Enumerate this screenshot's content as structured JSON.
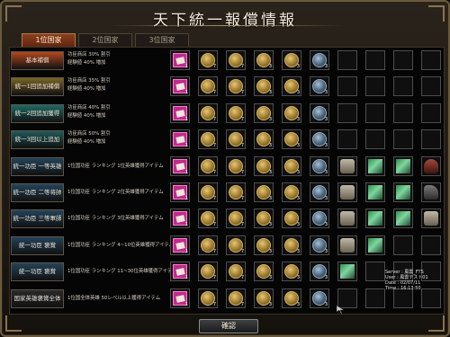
{
  "window": {
    "title": "天下統一報償情報",
    "confirm_label": "確認"
  },
  "tabs": [
    {
      "label": "1位国家",
      "active": true
    },
    {
      "label": "2位国家",
      "active": false
    },
    {
      "label": "3位国家",
      "active": false
    }
  ],
  "rows": [
    {
      "rank": "基本補償",
      "rank_color": "#b0481f",
      "line1": "功臣商店 30% 割引",
      "line2": "経験値 40% 増加",
      "items": [
        {
          "icon": "scroll-icon",
          "qty": "1"
        },
        {
          "icon": "coin-icon",
          "qty": "7"
        },
        {
          "icon": "coin-icon",
          "qty": "7"
        },
        {
          "icon": "coin-icon",
          "qty": "3"
        },
        {
          "icon": "coin-icon",
          "qty": "3"
        },
        {
          "icon": "coin-blue-icon",
          "qty": "3"
        }
      ]
    },
    {
      "rank": "統一1回追加補償",
      "rank_color": "#7a6427",
      "line1": "功臣商店 35% 割引",
      "line2": "経験値 40% 増加",
      "items": [
        {
          "icon": "scroll-icon",
          "qty": "1"
        },
        {
          "icon": "coin-icon",
          "qty": "7"
        },
        {
          "icon": "coin-icon",
          "qty": "7"
        },
        {
          "icon": "coin-icon",
          "qty": "3"
        },
        {
          "icon": "coin-icon",
          "qty": "3"
        },
        {
          "icon": "coin-blue-icon",
          "qty": "3"
        }
      ]
    },
    {
      "rank": "統一2回追加獲得",
      "rank_color": "#1f6a64",
      "line1": "功臣商店 40% 割引",
      "line2": "経験値 40% 増加",
      "items": [
        {
          "icon": "scroll-icon",
          "qty": "1"
        },
        {
          "icon": "coin-icon",
          "qty": "7"
        },
        {
          "icon": "coin-icon",
          "qty": "7"
        },
        {
          "icon": "coin-icon",
          "qty": "3"
        },
        {
          "icon": "coin-icon",
          "qty": "3"
        },
        {
          "icon": "coin-blue-icon",
          "qty": "3"
        }
      ]
    },
    {
      "rank": "統一3回以上追加",
      "rank_color": "#1f5a5a",
      "line1": "功臣商店 50% 割引",
      "line2": "経験値 40% 増加",
      "items": [
        {
          "icon": "scroll-icon",
          "qty": "1"
        },
        {
          "icon": "coin-icon",
          "qty": "7"
        },
        {
          "icon": "coin-icon",
          "qty": "7"
        },
        {
          "icon": "coin-icon",
          "qty": "3"
        },
        {
          "icon": "coin-icon",
          "qty": "3"
        },
        {
          "icon": "coin-blue-icon",
          "qty": "3"
        }
      ]
    },
    {
      "rank": "統一功臣 一等英雄",
      "rank_color": "#24435a",
      "line1": "1位国功臣 ランキング 1位英雄獲得アイテム",
      "line2": "",
      "items": [
        {
          "icon": "scroll-icon",
          "qty": "1"
        },
        {
          "icon": "coin-icon",
          "qty": "7"
        },
        {
          "icon": "coin-icon",
          "qty": "7"
        },
        {
          "icon": "coin-icon",
          "qty": "3"
        },
        {
          "icon": "coin-icon",
          "qty": "3"
        },
        {
          "icon": "coin-blue-icon",
          "qty": "3"
        },
        {
          "icon": "armor-icon",
          "qty": ""
        },
        {
          "icon": "gear-icon",
          "qty": ""
        },
        {
          "icon": "gear-icon",
          "qty": ""
        },
        {
          "icon": "helm-icon",
          "qty": ""
        }
      ]
    },
    {
      "rank": "統一功臣 二等将帥",
      "rank_color": "#24435a",
      "line1": "1位国功臣 ランキング 2位英雄獲得アイテム",
      "line2": "",
      "items": [
        {
          "icon": "scroll-icon",
          "qty": "1"
        },
        {
          "icon": "coin-icon",
          "qty": "7"
        },
        {
          "icon": "coin-icon",
          "qty": "7"
        },
        {
          "icon": "coin-icon",
          "qty": "3"
        },
        {
          "icon": "coin-icon",
          "qty": "3"
        },
        {
          "icon": "coin-blue-icon",
          "qty": "3"
        },
        {
          "icon": "armor-icon",
          "qty": ""
        },
        {
          "icon": "gear-icon",
          "qty": ""
        },
        {
          "icon": "gear-icon",
          "qty": ""
        },
        {
          "icon": "horse-icon",
          "qty": ""
        }
      ]
    },
    {
      "rank": "統一功臣 三等軍師",
      "rank_color": "#24435a",
      "line1": "1位国功臣 ランキング 3位英雄獲得アイテム",
      "line2": "",
      "items": [
        {
          "icon": "scroll-icon",
          "qty": "1"
        },
        {
          "icon": "coin-icon",
          "qty": "7"
        },
        {
          "icon": "coin-icon",
          "qty": "7"
        },
        {
          "icon": "coin-icon",
          "qty": "3"
        },
        {
          "icon": "coin-icon",
          "qty": "3"
        },
        {
          "icon": "coin-blue-icon",
          "qty": "3"
        },
        {
          "icon": "armor-icon",
          "qty": ""
        },
        {
          "icon": "gear-icon",
          "qty": ""
        },
        {
          "icon": "gear-icon",
          "qty": ""
        },
        {
          "icon": "armor-icon",
          "qty": ""
        }
      ]
    },
    {
      "rank": "統一功臣 褒賞",
      "rank_color": "#24435a",
      "line1": "1位国功臣 ランキング 4~10位英雄獲得アイテム",
      "line2": "",
      "items": [
        {
          "icon": "scroll-icon",
          "qty": "1"
        },
        {
          "icon": "coin-icon",
          "qty": "7"
        },
        {
          "icon": "coin-icon",
          "qty": "7"
        },
        {
          "icon": "coin-icon",
          "qty": "3"
        },
        {
          "icon": "coin-icon",
          "qty": "3"
        },
        {
          "icon": "coin-blue-icon",
          "qty": "3"
        },
        {
          "icon": "armor-icon",
          "qty": ""
        },
        {
          "icon": "gear-icon",
          "qty": ""
        }
      ]
    },
    {
      "rank": "統一功臣 褒賞",
      "rank_color": "#24435a",
      "line1": "1位国功臣 ランキング 11~30位英雄獲得アイテム",
      "line2": "",
      "items": [
        {
          "icon": "scroll-icon",
          "qty": "1"
        },
        {
          "icon": "coin-icon",
          "qty": "7"
        },
        {
          "icon": "coin-icon",
          "qty": "7"
        },
        {
          "icon": "coin-icon",
          "qty": "3"
        },
        {
          "icon": "coin-icon",
          "qty": "3"
        },
        {
          "icon": "coin-blue-icon",
          "qty": "3"
        },
        {
          "icon": "gear-icon",
          "qty": ""
        }
      ]
    },
    {
      "rank": "国家英雄褒賞全体",
      "rank_color": "#2a2a2a",
      "line1": "1位国全体英雄 50レベル以上獲得アイテム",
      "line2": "",
      "items": [
        {
          "icon": "scroll-icon",
          "qty": "1"
        },
        {
          "icon": "coin-icon",
          "qty": "7"
        },
        {
          "icon": "coin-icon",
          "qty": "7"
        },
        {
          "icon": "coin-icon",
          "qty": "3"
        },
        {
          "icon": "coin-icon",
          "qty": "3"
        },
        {
          "icon": "coin-blue-icon",
          "qty": "3"
        }
      ]
    }
  ],
  "server_info": {
    "server": "Server : 風雲_FTS",
    "user": "User : 風雲テスト01",
    "date": "Date : 02/07/11",
    "time": "Time : 16:13:50"
  }
}
